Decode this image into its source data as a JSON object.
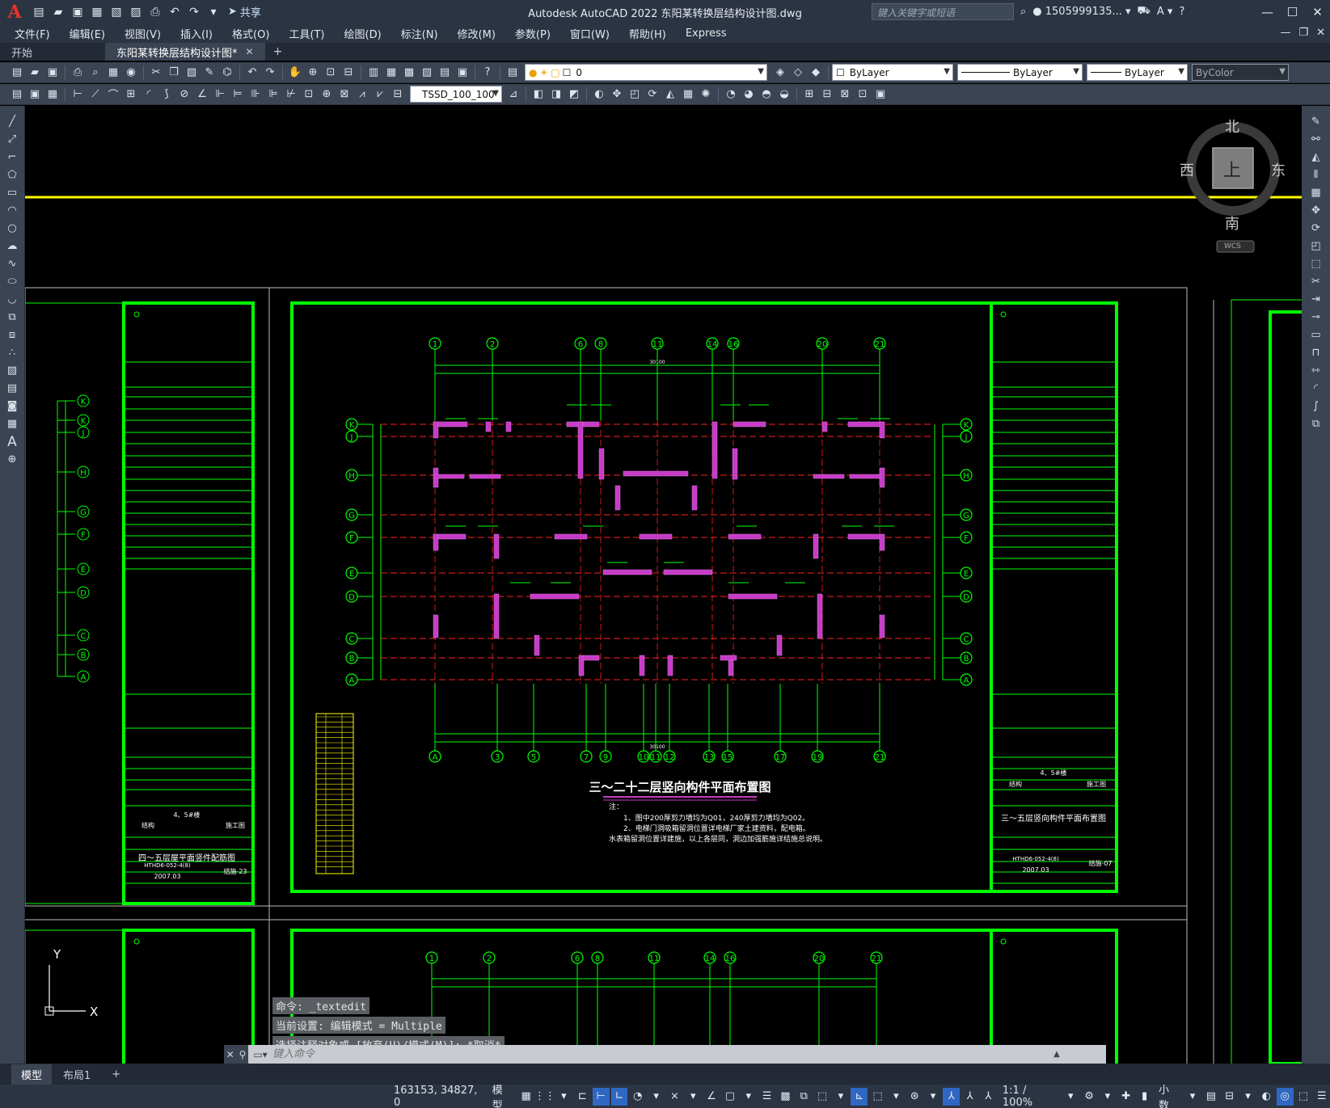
{
  "titlebar": {
    "logo": "A",
    "share_label": "共享",
    "app_title": "Autodesk AutoCAD 2022    东阳某转换层结构设计图.dwg",
    "search_placeholder": "键入关键字或短语",
    "user": "1505999135...",
    "help": "?"
  },
  "menu": {
    "items": [
      "文件(F)",
      "编辑(E)",
      "视图(V)",
      "插入(I)",
      "格式(O)",
      "工具(T)",
      "绘图(D)",
      "标注(N)",
      "修改(M)",
      "参数(P)",
      "窗口(W)",
      "帮助(H)",
      "Express"
    ]
  },
  "tabs": {
    "start": "开始",
    "active": "东阳某转换层结构设计图*",
    "add": "+"
  },
  "toolbar": {
    "layer_value": "0",
    "color_value": "ByLayer",
    "linetype_value": "ByLayer",
    "lineweight_value": "ByLayer",
    "plotstyle_value": "ByColor",
    "textstyle_value": "TSSD_100_100"
  },
  "viewcube": {
    "north": "北",
    "south": "南",
    "east": "东",
    "west": "西",
    "top": "上",
    "wcs": "WCS"
  },
  "drawing": {
    "main_title": "三～二十二层竖向构件平面布置图",
    "note_head": "注：",
    "note1": "1、图中200厚剪力墙均为Q01，240厚剪力墙均为Q02。",
    "note2": "2、电梯门洞吸箱留洞位置详电梯厂家土建资料，配电箱。",
    "note3": "水表箱留洞位置详建施，以上各层同，洞边加强筋施详结施总说明。",
    "top_axes": [
      "1",
      "2",
      "6",
      "8",
      "11",
      "14",
      "16",
      "20",
      "21"
    ],
    "bottom_axes": [
      "A",
      "3",
      "5",
      "7",
      "9",
      "10",
      "11",
      "12",
      "13",
      "15",
      "17",
      "19",
      "21"
    ],
    "row_axes": [
      "K",
      "J",
      "H",
      "G",
      "F",
      "E",
      "D",
      "C",
      "B",
      "A"
    ],
    "left_row_axes": [
      "K",
      "K",
      "J",
      "H",
      "G",
      "F",
      "E",
      "D",
      "C",
      "B",
      "A"
    ],
    "total_dim": "30100",
    "tb_left_drawing_name": "四～五层屋平面竖件配筋图",
    "tb_left_drawing_no": "结施-23",
    "tb_left_project_no": "HTHD6-052-4(8)",
    "tb_left_date": "2007.03",
    "tb_right_drawing_name": "三～五层竖向构件平面布置图",
    "tb_right_drawing_no": "结施-07",
    "tb_right_project_no": "HTHD6-052-4(8)",
    "tb_right_date": "2007.03",
    "tb_stage": "施工图",
    "tb_major": "结构",
    "tb_building": "4、5#楼"
  },
  "ucs": {
    "x": "X",
    "y": "Y"
  },
  "command": {
    "history": [
      "命令: _textedit",
      "当前设置: 编辑模式 = Multiple",
      "选择注释对象或 [放弃(U)/模式(M)]: *取消*"
    ],
    "placeholder": "键入命令"
  },
  "layout_tabs": [
    "模型",
    "布局1"
  ],
  "status": {
    "coords": "163153, 34827, 0",
    "model": "模型",
    "scale": "1:1 / 100%",
    "units": "小数"
  },
  "colors": {
    "background": "#000000",
    "frame_green": "#00ff00",
    "wall_magenta": "#c63cc6",
    "axis_red": "#ff2020",
    "yellow_line": "#ffff00",
    "ui_dark": "#2b3442",
    "ui_mid": "#3b4453"
  }
}
